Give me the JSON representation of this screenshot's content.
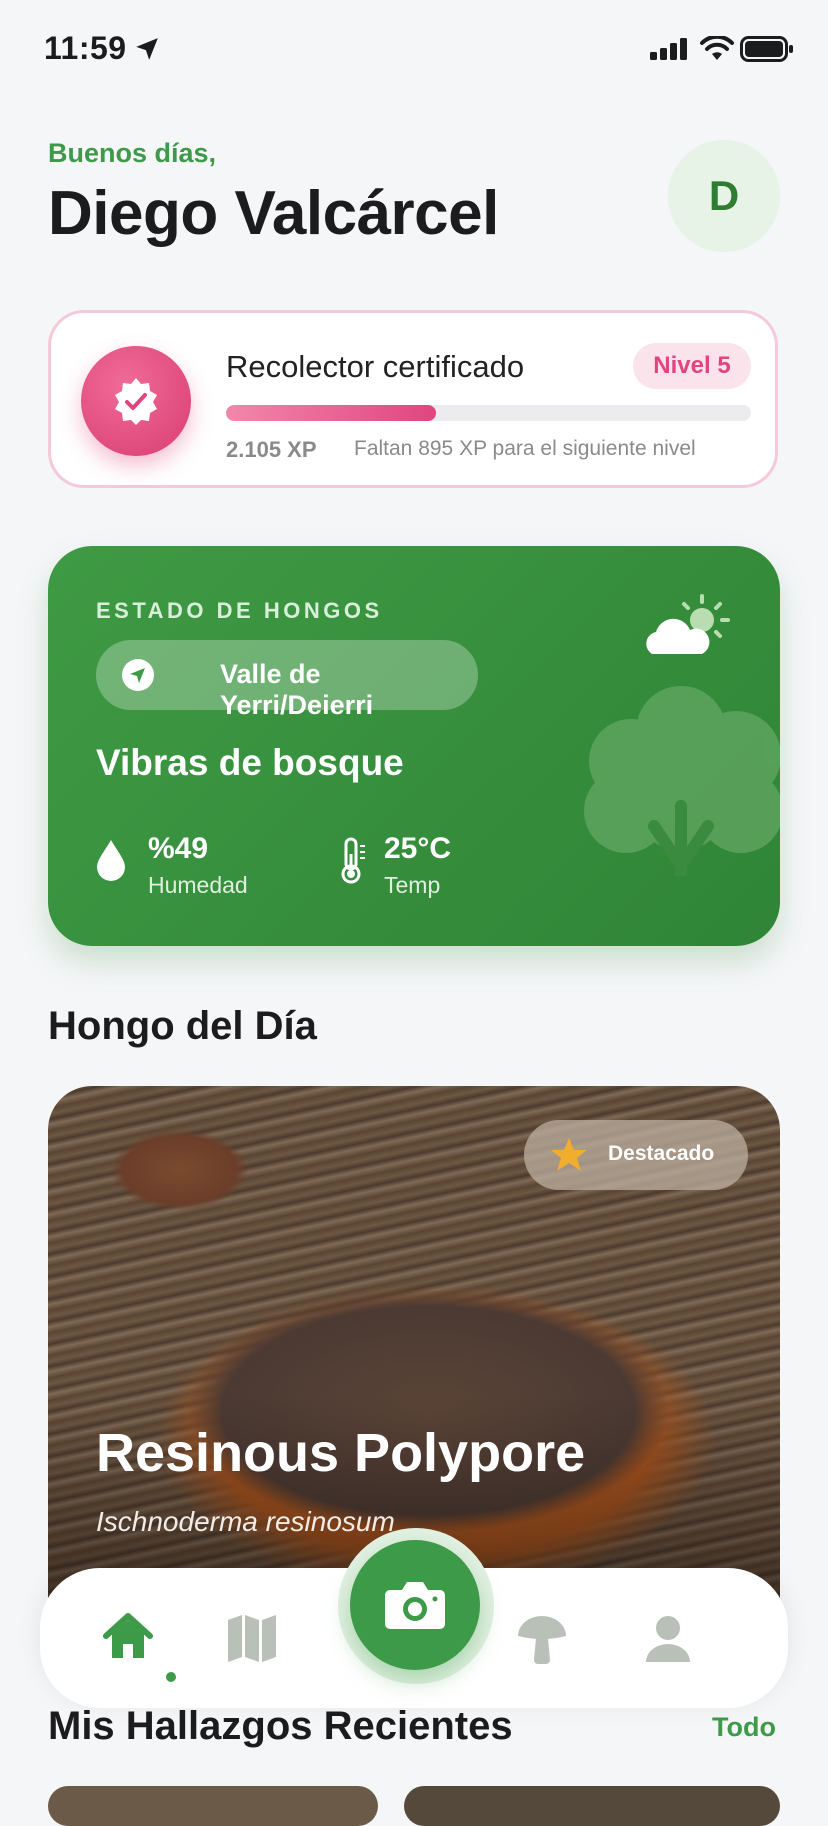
{
  "status_bar": {
    "time": "11:59"
  },
  "header": {
    "greeting": "Buenos días,",
    "user_name": "Diego Valcárcel",
    "avatar_initial": "D"
  },
  "level": {
    "title": "Recolector certificado",
    "badge": "Nivel 5",
    "xp": "2.105 XP",
    "next_level_text": "Faltan 895 XP para el siguiente nivel",
    "progress_fraction": 0.4
  },
  "weather": {
    "title": "ESTADO DE HONGOS",
    "location": "Valle de Yerri/Deierri",
    "vibe": "Vibras de bosque",
    "humidity_value": "%49",
    "humidity_label": "Humedad",
    "temp_value": "25°C",
    "temp_label": "Temp",
    "card_color": "#3c9a48"
  },
  "featured": {
    "section_title": "Hongo del Día",
    "badge": "Destacado",
    "name": "Resinous Polypore",
    "scientific_name": "Ischnoderma resinosum"
  },
  "tabbar": {
    "items": [
      "home-icon",
      "map-icon",
      "camera-icon",
      "mushroom-icon",
      "profile-icon"
    ],
    "active": "home-icon",
    "accent": "#3c9a48"
  },
  "recent": {
    "title": "Mis Hallazgos Recientes",
    "all_link": "Todo"
  }
}
